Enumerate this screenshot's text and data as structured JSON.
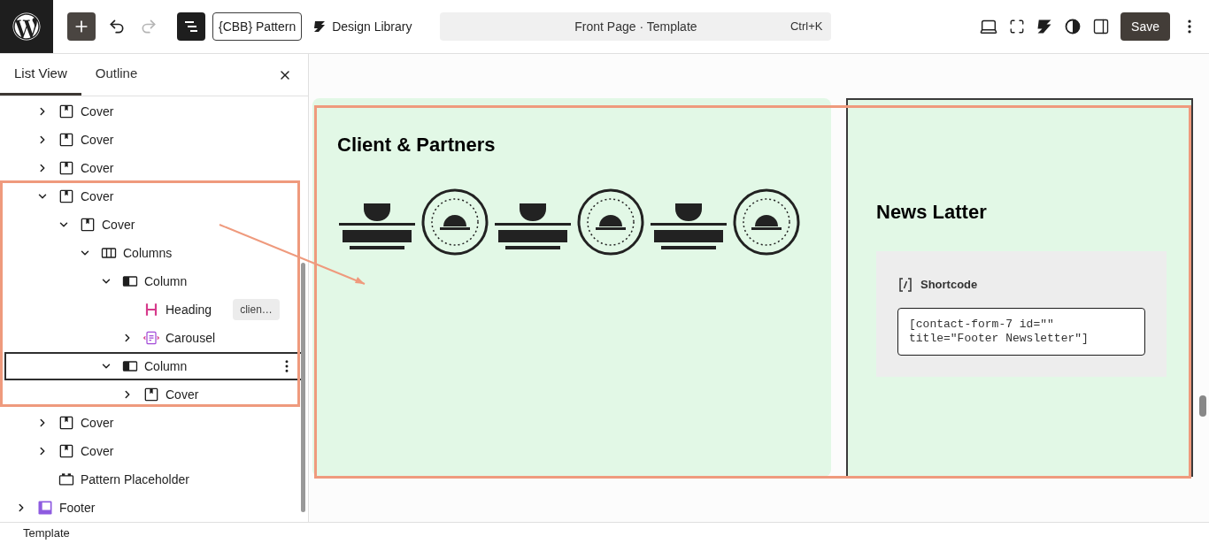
{
  "toolbar": {
    "add_active": true,
    "redo_disabled": true,
    "list_view_active": true,
    "pattern_button": "{CBB} Pattern",
    "library_button": "Design Library",
    "command_bar": {
      "title": "Front Page · Template",
      "shortcut": "Ctrl+K"
    },
    "save": "Save"
  },
  "sidebar": {
    "tabs": [
      {
        "label": "List View",
        "selected": true
      },
      {
        "label": "Outline",
        "selected": false
      }
    ],
    "tree": {
      "nested": [
        {
          "label": "Cover",
          "kind": "cover",
          "expanded": false,
          "selected": false
        },
        {
          "label": "Cover",
          "kind": "cover",
          "expanded": false,
          "selected": false
        },
        {
          "label": "Cover",
          "kind": "cover",
          "expanded": false,
          "selected": false
        },
        {
          "label": "Cover",
          "kind": "cover",
          "expanded": true,
          "selected": false,
          "children": [
            {
              "label": "Cover",
              "kind": "cover",
              "expanded": true,
              "selected": false,
              "children": [
                {
                  "label": "Columns",
                  "kind": "columns",
                  "expanded": true,
                  "selected": false,
                  "children": [
                    {
                      "label": "Column",
                      "kind": "column",
                      "expanded": true,
                      "selected": false,
                      "children": [
                        {
                          "label": "Heading",
                          "kind": "heading",
                          "selected": false,
                          "badge": "clien…"
                        },
                        {
                          "label": "Carousel",
                          "kind": "carousel",
                          "expanded": false,
                          "selected": false
                        }
                      ]
                    },
                    {
                      "label": "Column",
                      "kind": "column",
                      "expanded": true,
                      "selected": true,
                      "children": [
                        {
                          "label": "Cover",
                          "kind": "cover",
                          "expanded": false,
                          "selected": false
                        }
                      ]
                    }
                  ]
                }
              ]
            }
          ]
        },
        {
          "label": "Cover",
          "kind": "cover",
          "expanded": false,
          "selected": false
        },
        {
          "label": "Cover",
          "kind": "cover",
          "expanded": false,
          "selected": false
        },
        {
          "label": "Pattern Placeholder",
          "kind": "pattern",
          "selected": false
        }
      ],
      "top_level": [
        {
          "label": "Footer",
          "kind": "footer",
          "expanded": false,
          "selected": false
        }
      ]
    }
  },
  "canvas": {
    "partners": {
      "heading": "Client & Partners"
    },
    "newsletter": {
      "heading": "News Latter",
      "shortcode": {
        "label": "Shortcode",
        "value": "[contact-form-7 id=\"\" title=\"Footer Newsletter\"]"
      }
    }
  },
  "status_bar": {
    "breadcrumb": "Template"
  }
}
